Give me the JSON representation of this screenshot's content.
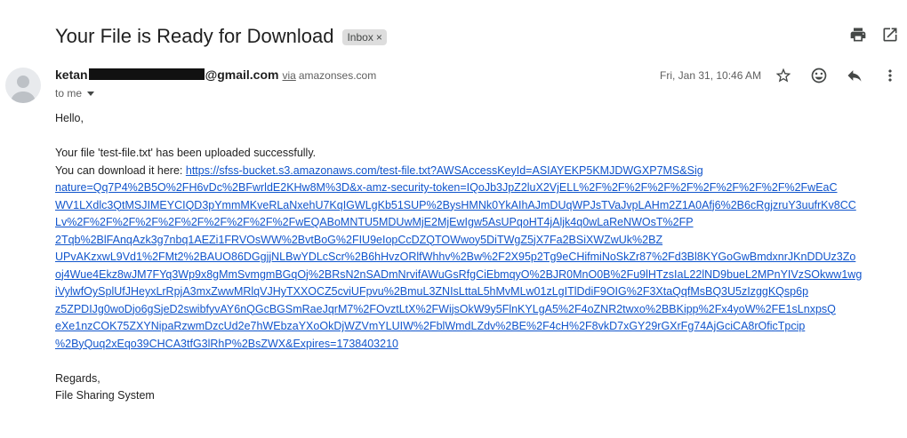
{
  "email": {
    "subject": "Your File is Ready for Download",
    "label": "Inbox",
    "label_remove": "×",
    "sender_prefix": "ketan",
    "sender_suffix": "@gmail.com",
    "via_label": "via",
    "via_domain": "amazonses.com",
    "recipient": "to me",
    "date": "Fri, Jan 31, 10:46 AM"
  },
  "body": {
    "greeting": "Hello,",
    "line1": "Your file 'test-file.txt' has been uploaded successfully.",
    "line2_prefix": "You can download it here: ",
    "url_lines": [
      "https://sfss-bucket.s3.amazonaws.com/test-file.txt?AWSAccessKeyId=ASIAYEKP5KMJDWGXP7MS&Sig",
      "nature=Qq7P4%2B5O%2FH6vDc%2BFwrldE2KHw8M%3D&x-amz-security-token=IQoJb3JpZ2luX2VjELL%2F%2F%2F%2F%2F%2F%2F%2F%2F%2FwEaC",
      "WV1LXdlc3QtMSJIMEYCIQD3pYmmMKveRLaNxehU7KqIGWLgKb51SUP%2BysHMNk0YkAIhAJmDUqWPJsTVaJvpLAHm2Z1A0Afj6%2B6cRgjzruY3uufrKv8CC",
      "Lv%2F%2F%2F%2F%2F%2F%2F%2F%2F%2FwEQABoMNTU5MDUwMjE2MjEwIgw5AsUPqoHT4jAljk4q0wLaReNWOsT%2FP",
      "2Tqb%2BlFAnqAzk3g7nbq1AEZi1FRVOsWW%2BvtBoG%2FIU9eIopCcDZQTOWwoy5DiTWgZ5jX7Fa2BSiXWZwUk%2BZ",
      "UPvAKzxwL9Vd1%2FMt2%2BAUO86DGgjjNLBwYDLcScr%2B6hHvzORlfWhhv%2Bw%2F2X95p2Tg9eCHifmiNoSkZr87%2Fd3Bl8KYGoGwBmdxnrJKnDDUz3Zo",
      "oj4Wue4Ekz8wJM7FYq3Wp9x8gMmSvmgmBGqOj%2BRsN2nSADmNrvifAWuGsRfgCiEbmqyO%2BJR0MnO0B%2Fu9lHTzsIaL22lND9bueL2MPnYIVzSOkww1wg",
      "iVylwfOySplUfJHeyxLrRpjA3mxZwwMRlqVJHyTXXOCZ5cviUFpvu%2BmuL3ZNIsLttaL5hMvMLw01zLgITlDdiF9OIG%2F3XtaQqfMsBQ3U5zIzggKQsp6p",
      "z5ZPDIJg0woDjo6gSjeD2swibfyvAY6nQGcBGSmRaeJqrM7%2FOvztLtX%2FWijsOkW9y5FlnKYLgA5%2F4oZNR2twxo%2BBKipp%2Fx4yoW%2FE1sLnxpsQ",
      "eXe1nzCOK75ZXYNipaRzwmDzcUd2e7hWEbzaYXoOkDjWZVmYLUIW%2FblWmdLZdv%2BE%2F4cH%2F8vkD7xGY29rGXrFg74AjGciCA8rOficTpcip",
      "%2ByQuq2xEqo39CHCA3tfG3lRhP%2BsZWX&Expires=1738403210"
    ],
    "regards": "Regards,",
    "signature": "File Sharing System"
  },
  "icons": {
    "print": "print-icon",
    "open_new_window": "open-in-new-icon",
    "star": "star-icon",
    "emoji": "emoji-icon",
    "reply": "reply-icon",
    "more": "more-vertical-icon",
    "avatar": "avatar-icon"
  }
}
